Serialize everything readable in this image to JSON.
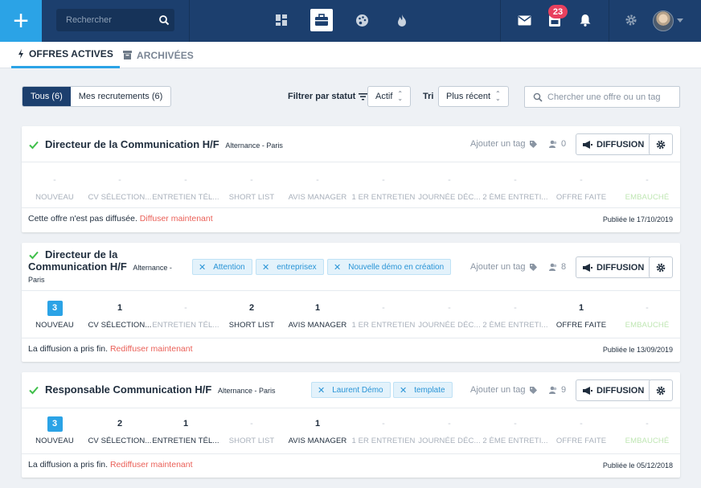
{
  "topbar": {
    "search_placeholder": "Rechercher",
    "notifications_badge": "23",
    "icons": [
      "plus-icon",
      "search-icon",
      "dashboard-icon",
      "briefcase-icon",
      "palette-icon",
      "fire-icon",
      "mail-icon",
      "inbox-icon",
      "bell-icon",
      "gear-icon",
      "avatar",
      "chevron-down-icon"
    ]
  },
  "tabs": [
    {
      "label": "OFFRES ACTIVES",
      "icon": "bolt-icon",
      "active": true
    },
    {
      "label": "ARCHIVÉES",
      "icon": "archive-icon",
      "active": false
    }
  ],
  "filters": {
    "segments": [
      "Tous (6)",
      "Mes recrutements (6)"
    ],
    "status_label": "Filtrer par statut",
    "status_value": "Actif",
    "sort_label": "Tri",
    "sort_value": "Plus récent",
    "search_placeholder": "Chercher une offre ou un tag"
  },
  "offers": [
    {
      "title": "Directeur de la Communication H/F",
      "meta": "Alternance - Paris",
      "add_tag": "Ajouter un tag",
      "count": "0",
      "diffusion": "DIFFUSION",
      "stages": [
        {
          "value": "-",
          "label": "NOUVEAU"
        },
        {
          "value": "-",
          "label": "CV SÉLECTION..."
        },
        {
          "value": "-",
          "label": "ENTRETIEN TÉL..."
        },
        {
          "value": "-",
          "label": "SHORT LIST"
        },
        {
          "value": "-",
          "label": "AVIS MANAGER"
        },
        {
          "value": "-",
          "label": "1 ER ENTRETIEN"
        },
        {
          "value": "-",
          "label": "JOURNÉE DÉC..."
        },
        {
          "value": "-",
          "label": "2 ÈME ENTRETI..."
        },
        {
          "value": "-",
          "label": "OFFRE FAITE"
        },
        {
          "value": "-",
          "label": "EMBAUCHÉ"
        }
      ],
      "footer_text": "Cette offre n'est pas diffusée.",
      "footer_link": "Diffuser maintenant",
      "published": "Publiée le 17/10/2019"
    },
    {
      "title_line1": "Directeur de la",
      "title_line2": "Communication H/F",
      "meta": "Alternance -",
      "meta_line2": "Paris",
      "tags": [
        "Attention",
        "entreprisex",
        "Nouvelle démo en création"
      ],
      "add_tag": "Ajouter un tag",
      "count": "8",
      "diffusion": "DIFFUSION",
      "stages": [
        {
          "value": "3",
          "label": "NOUVEAU"
        },
        {
          "value": "1",
          "label": "CV SÉLECTION..."
        },
        {
          "value": "-",
          "label": "ENTRETIEN TÉL..."
        },
        {
          "value": "2",
          "label": "SHORT LIST"
        },
        {
          "value": "1",
          "label": "AVIS MANAGER"
        },
        {
          "value": "-",
          "label": "1 ER ENTRETIEN"
        },
        {
          "value": "-",
          "label": "JOURNÉE DÉC..."
        },
        {
          "value": "-",
          "label": "2 ÈME ENTRETI..."
        },
        {
          "value": "1",
          "label": "OFFRE FAITE"
        },
        {
          "value": "-",
          "label": "EMBAUCHÉ"
        }
      ],
      "footer_text": "La diffusion a pris fin.",
      "footer_link": "Rediffuser maintenant",
      "published": "Publiée le 13/09/2019"
    },
    {
      "title": "Responsable Communication H/F",
      "meta": "Alternance - Paris",
      "tags": [
        "Laurent Démo",
        "template"
      ],
      "add_tag": "Ajouter un tag",
      "count": "9",
      "diffusion": "DIFFUSION",
      "stages": [
        {
          "value": "3",
          "label": "NOUVEAU"
        },
        {
          "value": "2",
          "label": "CV SÉLECTION..."
        },
        {
          "value": "1",
          "label": "ENTRETIEN TÉL..."
        },
        {
          "value": "-",
          "label": "SHORT LIST"
        },
        {
          "value": "1",
          "label": "AVIS MANAGER"
        },
        {
          "value": "-",
          "label": "1 ER ENTRETIEN"
        },
        {
          "value": "-",
          "label": "JOURNÉE DÉC..."
        },
        {
          "value": "-",
          "label": "2 ÈME ENTRETI..."
        },
        {
          "value": "-",
          "label": "OFFRE FAITE"
        },
        {
          "value": "-",
          "label": "EMBAUCHÉ"
        }
      ],
      "footer_text": "La diffusion a pris fin.",
      "footer_link": "Rediffuser maintenant",
      "published": "Publiée le 05/12/2018"
    }
  ]
}
